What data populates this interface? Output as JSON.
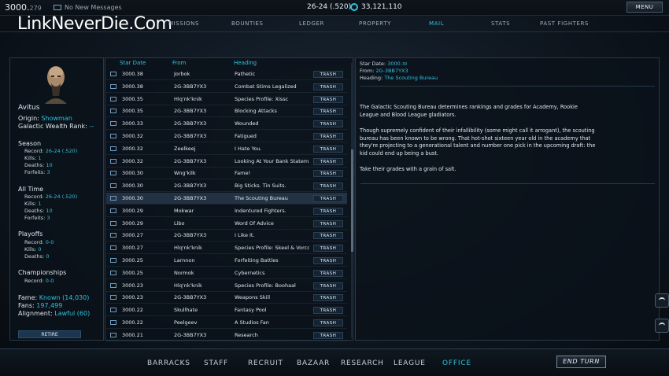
{
  "topbar": {
    "date_main": "3000.",
    "date_frac": "279",
    "messages": "No New Messages",
    "record": "26-24 (.520)",
    "wealth": "33,121,110",
    "menu_label": "MENU"
  },
  "watermark": "LinkNeverDie.Com",
  "tabs": [
    "MISSIONS",
    "BOUNTIES",
    "LEDGER",
    "PROPERTY",
    "MAIL",
    "STATS",
    "PAST FIGHTERS"
  ],
  "active_tab": "MAIL",
  "profile": {
    "name": "Avitus",
    "origin_label": "Origin:",
    "origin": "Showman",
    "rank_label": "Galactic Wealth Rank:",
    "rank": "--",
    "season": {
      "title": "Season",
      "record_label": "Record:",
      "record": "26-24 (.520)",
      "kills_label": "Kills:",
      "kills": "1",
      "deaths_label": "Deaths:",
      "deaths": "10",
      "forfeits_label": "Forfeits:",
      "forfeits": "3"
    },
    "alltime": {
      "title": "All Time",
      "record_label": "Record:",
      "record": "26-24 (.520)",
      "kills_label": "Kills:",
      "kills": "1",
      "deaths_label": "Deaths:",
      "deaths": "10",
      "forfeits_label": "Forfeits:",
      "forfeits": "3"
    },
    "playoffs": {
      "title": "Playoffs",
      "record_label": "Record:",
      "record": "0-0",
      "kills_label": "Kills:",
      "kills": "0",
      "deaths_label": "Deaths:",
      "deaths": "0"
    },
    "championships": {
      "title": "Championships",
      "record_label": "Record:",
      "record": "0-0"
    },
    "fame_label": "Fame:",
    "fame": "Known (14,030)",
    "fans_label": "Fans:",
    "fans": "197,499",
    "alignment_label": "Alignment:",
    "alignment": "Lawful (60)",
    "retire_label": "RETIRE"
  },
  "mail": {
    "headers": {
      "date": "Star Date",
      "from": "From",
      "heading": "Heading"
    },
    "trash_label": "TRASH",
    "rows": [
      {
        "date": "3000.38",
        "from": "Jorbok",
        "heading": "Pathetic"
      },
      {
        "date": "3000.38",
        "from": "2G-3BB7YX3",
        "heading": "Combat Stims Legalized"
      },
      {
        "date": "3000.35",
        "from": "Hlq'nk'knik",
        "heading": "Species Profile: Xissc"
      },
      {
        "date": "3000.35",
        "from": "2G-3BB7YX3",
        "heading": "Blocking Attacks"
      },
      {
        "date": "3000.33",
        "from": "2G-3BB7YX3",
        "heading": "Wounded"
      },
      {
        "date": "3000.32",
        "from": "2G-3BB7YX3",
        "heading": "Fatigued"
      },
      {
        "date": "3000.32",
        "from": "Zeelkeej",
        "heading": "I Hate You."
      },
      {
        "date": "3000.32",
        "from": "2G-3BB7YX3",
        "heading": "Looking At Your Bank Statem..."
      },
      {
        "date": "3000.30",
        "from": "Wng'kilk",
        "heading": "Fame!"
      },
      {
        "date": "3000.30",
        "from": "2G-3BB7YX3",
        "heading": "Big Sticks. Tin Suits."
      },
      {
        "date": "3000.30",
        "from": "2G-3BB7YX3",
        "heading": "The Scouting Bureau",
        "selected": true
      },
      {
        "date": "3000.29",
        "from": "Mokwar",
        "heading": "Indentured Fighters."
      },
      {
        "date": "3000.29",
        "from": "Libo",
        "heading": "Word Of Advice"
      },
      {
        "date": "3000.27",
        "from": "2G-3BB7YX3",
        "heading": "I Like It."
      },
      {
        "date": "3000.27",
        "from": "Hlq'nk'knik",
        "heading": "Species Profile: Skeel & Vorcci..."
      },
      {
        "date": "3000.25",
        "from": "Larnnon",
        "heading": "Forfeiting Battles"
      },
      {
        "date": "3000.25",
        "from": "Normok",
        "heading": "Cybernetics"
      },
      {
        "date": "3000.23",
        "from": "Hlq'nk'knik",
        "heading": "Species Profile: Boohaal"
      },
      {
        "date": "3000.23",
        "from": "2G-3BB7YX3",
        "heading": "Weapons Skill"
      },
      {
        "date": "3000.22",
        "from": "Skullhate",
        "heading": "Fantasy Pool"
      },
      {
        "date": "3000.22",
        "from": "Peelgeev",
        "heading": "A Studios Fan"
      },
      {
        "date": "3000.21",
        "from": "2G-3BB7YX3",
        "heading": "Research"
      }
    ]
  },
  "message": {
    "stardate_label": "Star Date:",
    "stardate_main": "3000.",
    "stardate_frac": "30",
    "from_label": "From:",
    "from": "2G-3BB7YX3",
    "heading_label": "Heading:",
    "heading": "The Scouting Bureau",
    "para1": "The Galactic Scouting Bureau determines rankings and grades for Academy, Rookie League and Blood League gladiators.",
    "para2": "Though supremely confident of their infallibility (some might call it arrogant), the scouting bureau has been known to be wrong. That hot-shot sixteen year old in the academy that they're projecting to a generational talent and number one pick in the upcoming draft: the kid could end up being a bust.",
    "para3": "Take their grades with a grain of salt."
  },
  "bottom_nav": [
    "BARRACKS",
    "STAFF",
    "RECRUIT",
    "BAZAAR",
    "RESEARCH",
    "LEAGUE",
    "OFFICE"
  ],
  "active_bottom": "OFFICE",
  "end_turn_label": "END TURN",
  "colors": {
    "accent": "#2fc3de",
    "panel_border": "#26394a"
  }
}
